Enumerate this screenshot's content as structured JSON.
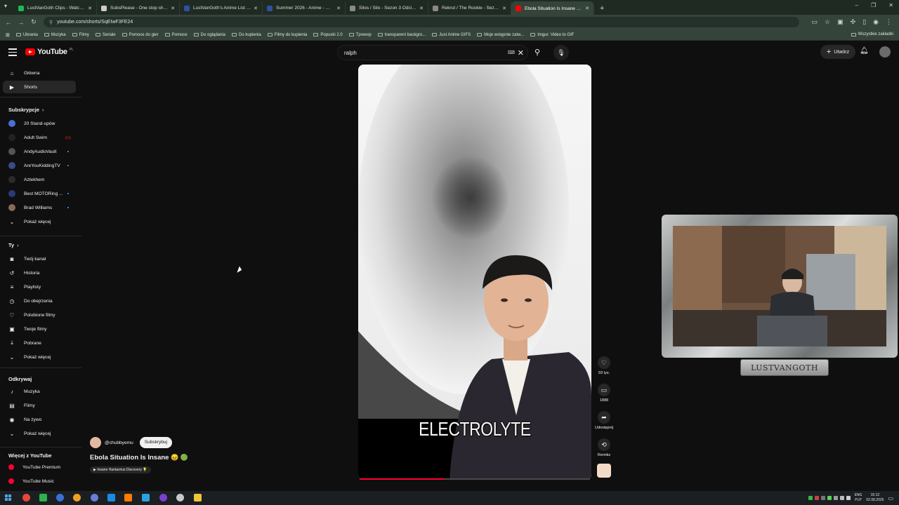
{
  "browser": {
    "tabs": [
      {
        "title": "LustVanGoth Clips - Watch Live",
        "fav": "#1db954"
      },
      {
        "title": "SubsPlease - One stop shop fo",
        "fav": "#cccccc"
      },
      {
        "title": "LustVanGoth's Anime List - My",
        "fav": "#2e51a2"
      },
      {
        "title": "Summer 2026 - Anime - MyAn",
        "fav": "#2e51a2"
      },
      {
        "title": "Silos / Silo - Sezon 3 Odcinek 2",
        "fav": "#8a8a8a"
      },
      {
        "title": "Rekrut / The Rookie - Sezon 2",
        "fav": "#8a8a8a"
      },
      {
        "title": "Ebola Situation Is Insane 😖 🔊",
        "fav": "#ff0000"
      }
    ],
    "new_tab": "+",
    "url": "youtube.com/shorts/SqEIwF3FE24",
    "bookmarks": [
      "Ubrania",
      "Muzyka",
      "Filmy",
      "Seriale",
      "Pomoce do gier",
      "Pomoce",
      "Do oglądania",
      "Do kupienia",
      "Filmy do kupienia",
      "Popuski 2.0",
      "Tpreexp",
      "transparent backgro...",
      "Just Anime GIFS",
      "Moje wstępnie zatw...",
      "Imgur: Video to GIF"
    ],
    "bookmarks_right": "Wszystkie zakładki"
  },
  "youtube": {
    "logo_text": "YouTube",
    "region": "PL",
    "search_value": "ralph",
    "create_label": "Utwórz"
  },
  "sidebar": {
    "top": [
      {
        "label": "Główna",
        "icon": "home-icon",
        "glyph": "⌂"
      },
      {
        "label": "Shorts",
        "icon": "shorts-icon",
        "glyph": "▶"
      }
    ],
    "subs_heading": "Subskrypcje",
    "subs": [
      {
        "label": "20 Stand-upów",
        "color": "#4a6fd8",
        "dot": false
      },
      {
        "label": "Adult Swim",
        "color": "#222222",
        "dot": false,
        "live": "((•))"
      },
      {
        "label": "AndyAudioVault",
        "color": "#555555",
        "dot": true
      },
      {
        "label": "AreYouKiddingTV",
        "color": "#3a4a8a",
        "dot": true
      },
      {
        "label": "Aztekhem",
        "color": "#2b2b2b",
        "dot": false
      },
      {
        "label": "Best MOTORing ...",
        "color": "#2a3a7a",
        "dot": true
      },
      {
        "label": "Brad Williams",
        "color": "#8a6a5a",
        "dot": true
      }
    ],
    "subs_more": "Pokaż więcej",
    "you_heading": "Ty",
    "you": [
      {
        "label": "Twój kanał",
        "icon": "your-channel-icon",
        "glyph": "◙"
      },
      {
        "label": "Historia",
        "icon": "history-icon",
        "glyph": "↺"
      },
      {
        "label": "Playlisty",
        "icon": "playlists-icon",
        "glyph": "≡"
      },
      {
        "label": "Do obejrzenia",
        "icon": "watch-later-icon",
        "glyph": "◷"
      },
      {
        "label": "Polubione filmy",
        "icon": "like-icon",
        "glyph": "♡"
      },
      {
        "label": "Twoje filmy",
        "icon": "your-videos-icon",
        "glyph": "▣"
      },
      {
        "label": "Pobrane",
        "icon": "download-icon",
        "glyph": "⤓"
      }
    ],
    "you_more": "Pokaż więcej",
    "explore_heading": "Odkrywaj",
    "explore": [
      {
        "label": "Muzyka",
        "icon": "music-icon",
        "glyph": "♪"
      },
      {
        "label": "Filmy",
        "icon": "movies-icon",
        "glyph": "▤"
      },
      {
        "label": "Na żywo",
        "icon": "live-icon",
        "glyph": "◉"
      }
    ],
    "explore_more": "Pokaż więcej",
    "more_heading": "Więcej z YouTube",
    "more": [
      {
        "label": "YouTube Premium",
        "color": "#ff0033"
      },
      {
        "label": "YouTube Music",
        "color": "#ff0033"
      }
    ]
  },
  "short": {
    "caption": "ELECTROLYTE",
    "progress": 0.37,
    "channel": "@chubbyemu",
    "subscribe": "Subskrybuj",
    "title": "Ebola Situation Is Insane",
    "title_emoji": "😖 🟢",
    "chip": "▶ Insane Hantavirus Discovery 💡",
    "actions": [
      {
        "name": "like",
        "glyph": "♡",
        "label": "93 tys."
      },
      {
        "name": "comments",
        "glyph": "▭",
        "label": "1888"
      },
      {
        "name": "share",
        "glyph": "➦",
        "label": "Udostępnij"
      },
      {
        "name": "remix",
        "glyph": "⟲",
        "label": "Remiks"
      }
    ]
  },
  "overlay": {
    "plate": "LUSTVANGOTH"
  },
  "taskbar": {
    "lang": "ENG",
    "lang2": "PLP",
    "time": "15:12",
    "date": "02.08.2026"
  }
}
